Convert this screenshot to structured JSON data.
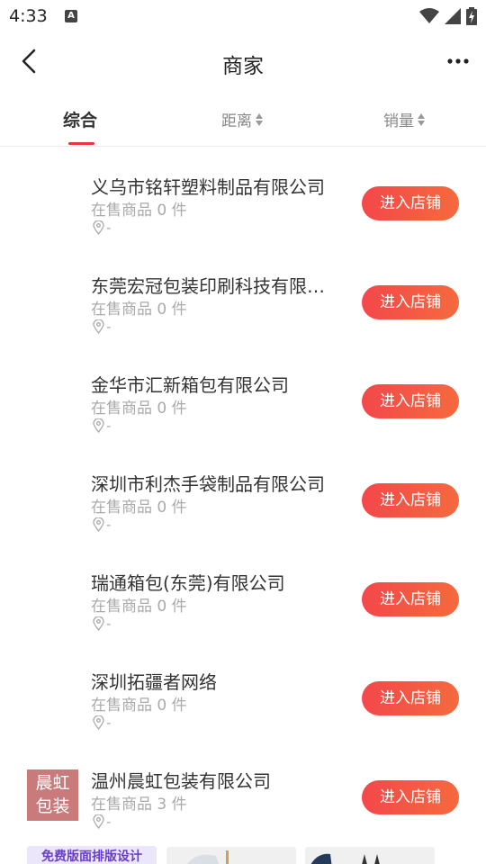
{
  "status_bar": {
    "time": "4:33",
    "notification_letter": "A"
  },
  "header": {
    "title": "商家"
  },
  "tabs": [
    {
      "label": "综合",
      "active": true
    },
    {
      "label": "距离",
      "sortable": true
    },
    {
      "label": "销量",
      "sortable": true
    }
  ],
  "stores": [
    {
      "name": "义乌市铭轩塑料制品有限公司",
      "count": "在售商品 0 件",
      "location": "-",
      "button": "进入店铺"
    },
    {
      "name": "东莞宏冠包装印刷科技有限…",
      "count": "在售商品 0 件",
      "location": "-",
      "button": "进入店铺"
    },
    {
      "name": "金华市汇新箱包有限公司",
      "count": "在售商品 0 件",
      "location": "-",
      "button": "进入店铺"
    },
    {
      "name": "深圳市利杰手袋制品有限公司",
      "count": "在售商品 0 件",
      "location": "-",
      "button": "进入店铺"
    },
    {
      "name": "瑞通箱包(东莞)有限公司",
      "count": "在售商品 0 件",
      "location": "-",
      "button": "进入店铺"
    },
    {
      "name": "深圳拓疆者网络",
      "count": "在售商品 0 件",
      "location": "-",
      "button": "进入店铺"
    },
    {
      "name": "温州晨虹包装有限公司",
      "count": "在售商品 3 件",
      "location": "-",
      "button": "进入店铺",
      "logo_line1": "晨虹",
      "logo_line2": "包装"
    }
  ],
  "bottom_strip": {
    "promo_label": "免费版面排版设计"
  },
  "colors": {
    "accent": "#e8343b",
    "button_start": "#f4474a",
    "button_end": "#f56a3e",
    "logo_bg": "#c97a7a"
  }
}
